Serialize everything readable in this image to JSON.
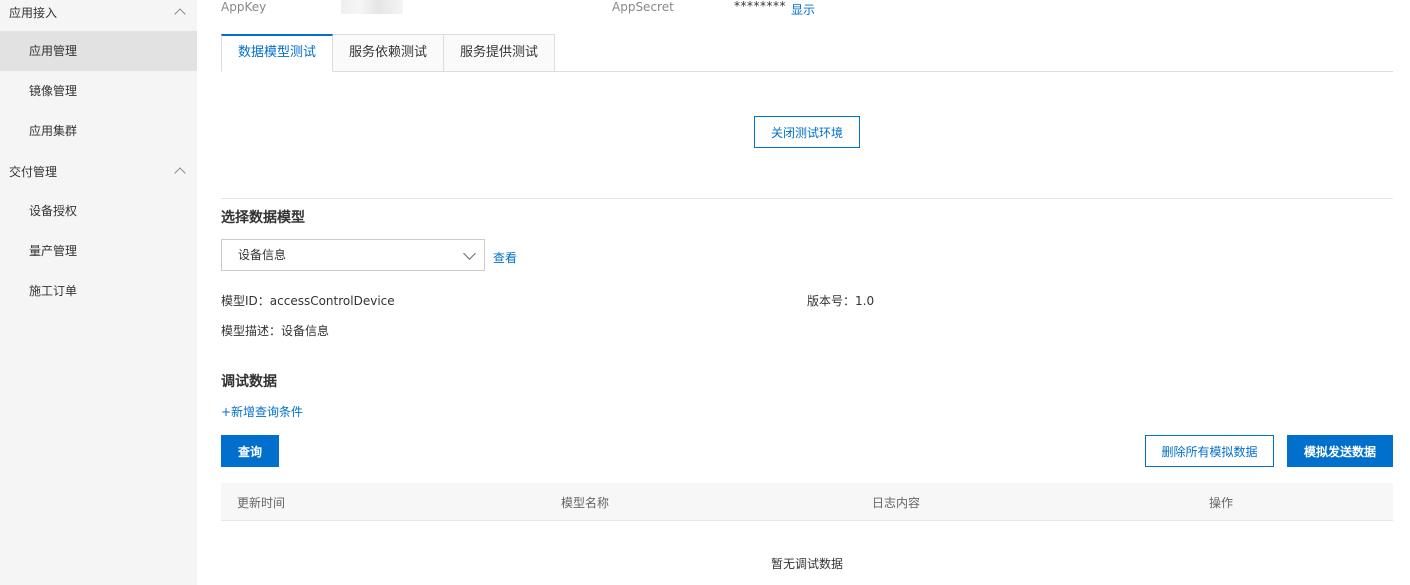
{
  "sidebar": {
    "groups": [
      {
        "title": "应用接入",
        "items": [
          "应用管理",
          "镜像管理",
          "应用集群"
        ],
        "active": 0
      },
      {
        "title": "交付管理",
        "items": [
          "设备授权",
          "量产管理",
          "施工订单"
        ]
      }
    ]
  },
  "header": {
    "appkey_label": "AppKey",
    "appsecret_label": "AppSecret",
    "appsecret_value": "********",
    "show_link": "显示"
  },
  "tabs": [
    "数据模型测试",
    "服务依赖测试",
    "服务提供测试"
  ],
  "close_env_button": "关闭测试环境",
  "model_section": {
    "title": "选择数据模型",
    "select_value": "设备信息",
    "view_link": "查看",
    "model_id": "模型ID：accessControlDevice",
    "version": "版本号：1.0",
    "description": "模型描述：设备信息"
  },
  "debug_section": {
    "title": "调试数据",
    "add_condition": "+新增查询条件",
    "query_button": "查询",
    "delete_all_button": "删除所有模拟数据",
    "simulate_button": "模拟发送数据"
  },
  "table": {
    "columns": [
      "更新时间",
      "模型名称",
      "日志内容",
      "操作"
    ],
    "empty_text": "暂无调试数据"
  },
  "colors": {
    "accent": "#0070cc",
    "sidebar_bg": "#f5f5f6"
  }
}
